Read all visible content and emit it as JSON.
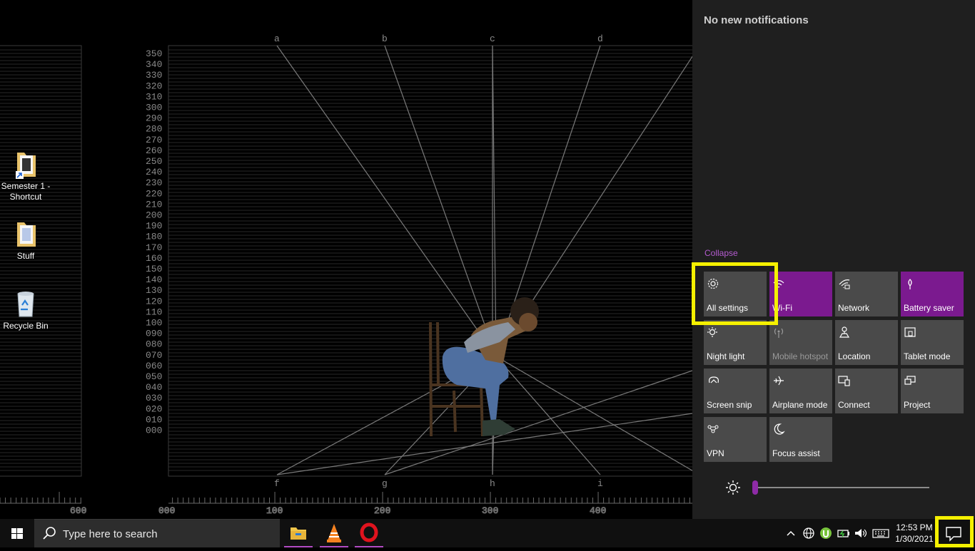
{
  "desktop": {
    "icons": [
      {
        "label": "Semester 1 - Shortcut",
        "icon": "folder-shortcut-icon"
      },
      {
        "label": "Stuff",
        "icon": "folder-icon"
      },
      {
        "label": "Recycle Bin",
        "icon": "recycle-bin-icon"
      }
    ],
    "wallpaper": {
      "y_ticks": [
        "350",
        "340",
        "330",
        "320",
        "310",
        "300",
        "290",
        "280",
        "270",
        "260",
        "250",
        "240",
        "230",
        "220",
        "210",
        "200",
        "190",
        "180",
        "170",
        "160",
        "150",
        "140",
        "130",
        "120",
        "110",
        "100",
        "090",
        "080",
        "070",
        "060",
        "050",
        "040",
        "030",
        "020",
        "010",
        "000"
      ],
      "top_letters": [
        "a",
        "b",
        "c",
        "d"
      ],
      "bottom_letters": [
        "f",
        "g",
        "h",
        "i"
      ],
      "ruler_labels": [
        "600",
        "000",
        "100",
        "200",
        "300",
        "400"
      ]
    }
  },
  "action_center": {
    "no_notifications": "No new notifications",
    "collapse": "Collapse",
    "tiles": [
      {
        "label": "All settings",
        "icon": "gear-icon",
        "state": "off"
      },
      {
        "label": "Wi-Fi",
        "icon": "wifi-icon",
        "state": "on"
      },
      {
        "label": "Network",
        "icon": "network-icon",
        "state": "off"
      },
      {
        "label": "Battery saver",
        "icon": "battery-saver-icon",
        "state": "on"
      },
      {
        "label": "Night light",
        "icon": "night-light-icon",
        "state": "off"
      },
      {
        "label": "Mobile hotspot",
        "icon": "mobile-hotspot-icon",
        "state": "disabled"
      },
      {
        "label": "Location",
        "icon": "location-icon",
        "state": "off"
      },
      {
        "label": "Tablet mode",
        "icon": "tablet-mode-icon",
        "state": "off"
      },
      {
        "label": "Screen snip",
        "icon": "screen-snip-icon",
        "state": "off"
      },
      {
        "label": "Airplane mode",
        "icon": "airplane-icon",
        "state": "off"
      },
      {
        "label": "Connect",
        "icon": "connect-icon",
        "state": "off"
      },
      {
        "label": "Project",
        "icon": "project-icon",
        "state": "off"
      },
      {
        "label": "VPN",
        "icon": "vpn-icon",
        "state": "off"
      },
      {
        "label": "Focus assist",
        "icon": "moon-icon",
        "state": "off"
      }
    ],
    "brightness": {
      "icon": "sun-icon",
      "level": 0.0
    }
  },
  "taskbar": {
    "search_placeholder": "Type here to search",
    "apps": [
      {
        "name": "File Explorer",
        "icon": "file-explorer-icon",
        "running": true
      },
      {
        "name": "VLC",
        "icon": "vlc-icon",
        "running": true
      },
      {
        "name": "Opera",
        "icon": "opera-icon",
        "running": true
      }
    ],
    "tray_icons": [
      "chevron-up-icon",
      "globe-icon",
      "utorrent-icon",
      "battery-icon",
      "volume-icon",
      "keyboard-icon"
    ],
    "time": "12:53 PM",
    "date": "1/30/2021"
  },
  "colors": {
    "accent": "#7b1a8f",
    "highlight": "#f5f000",
    "tile": "#4a4a4a",
    "panel": "#1f1f1f"
  }
}
